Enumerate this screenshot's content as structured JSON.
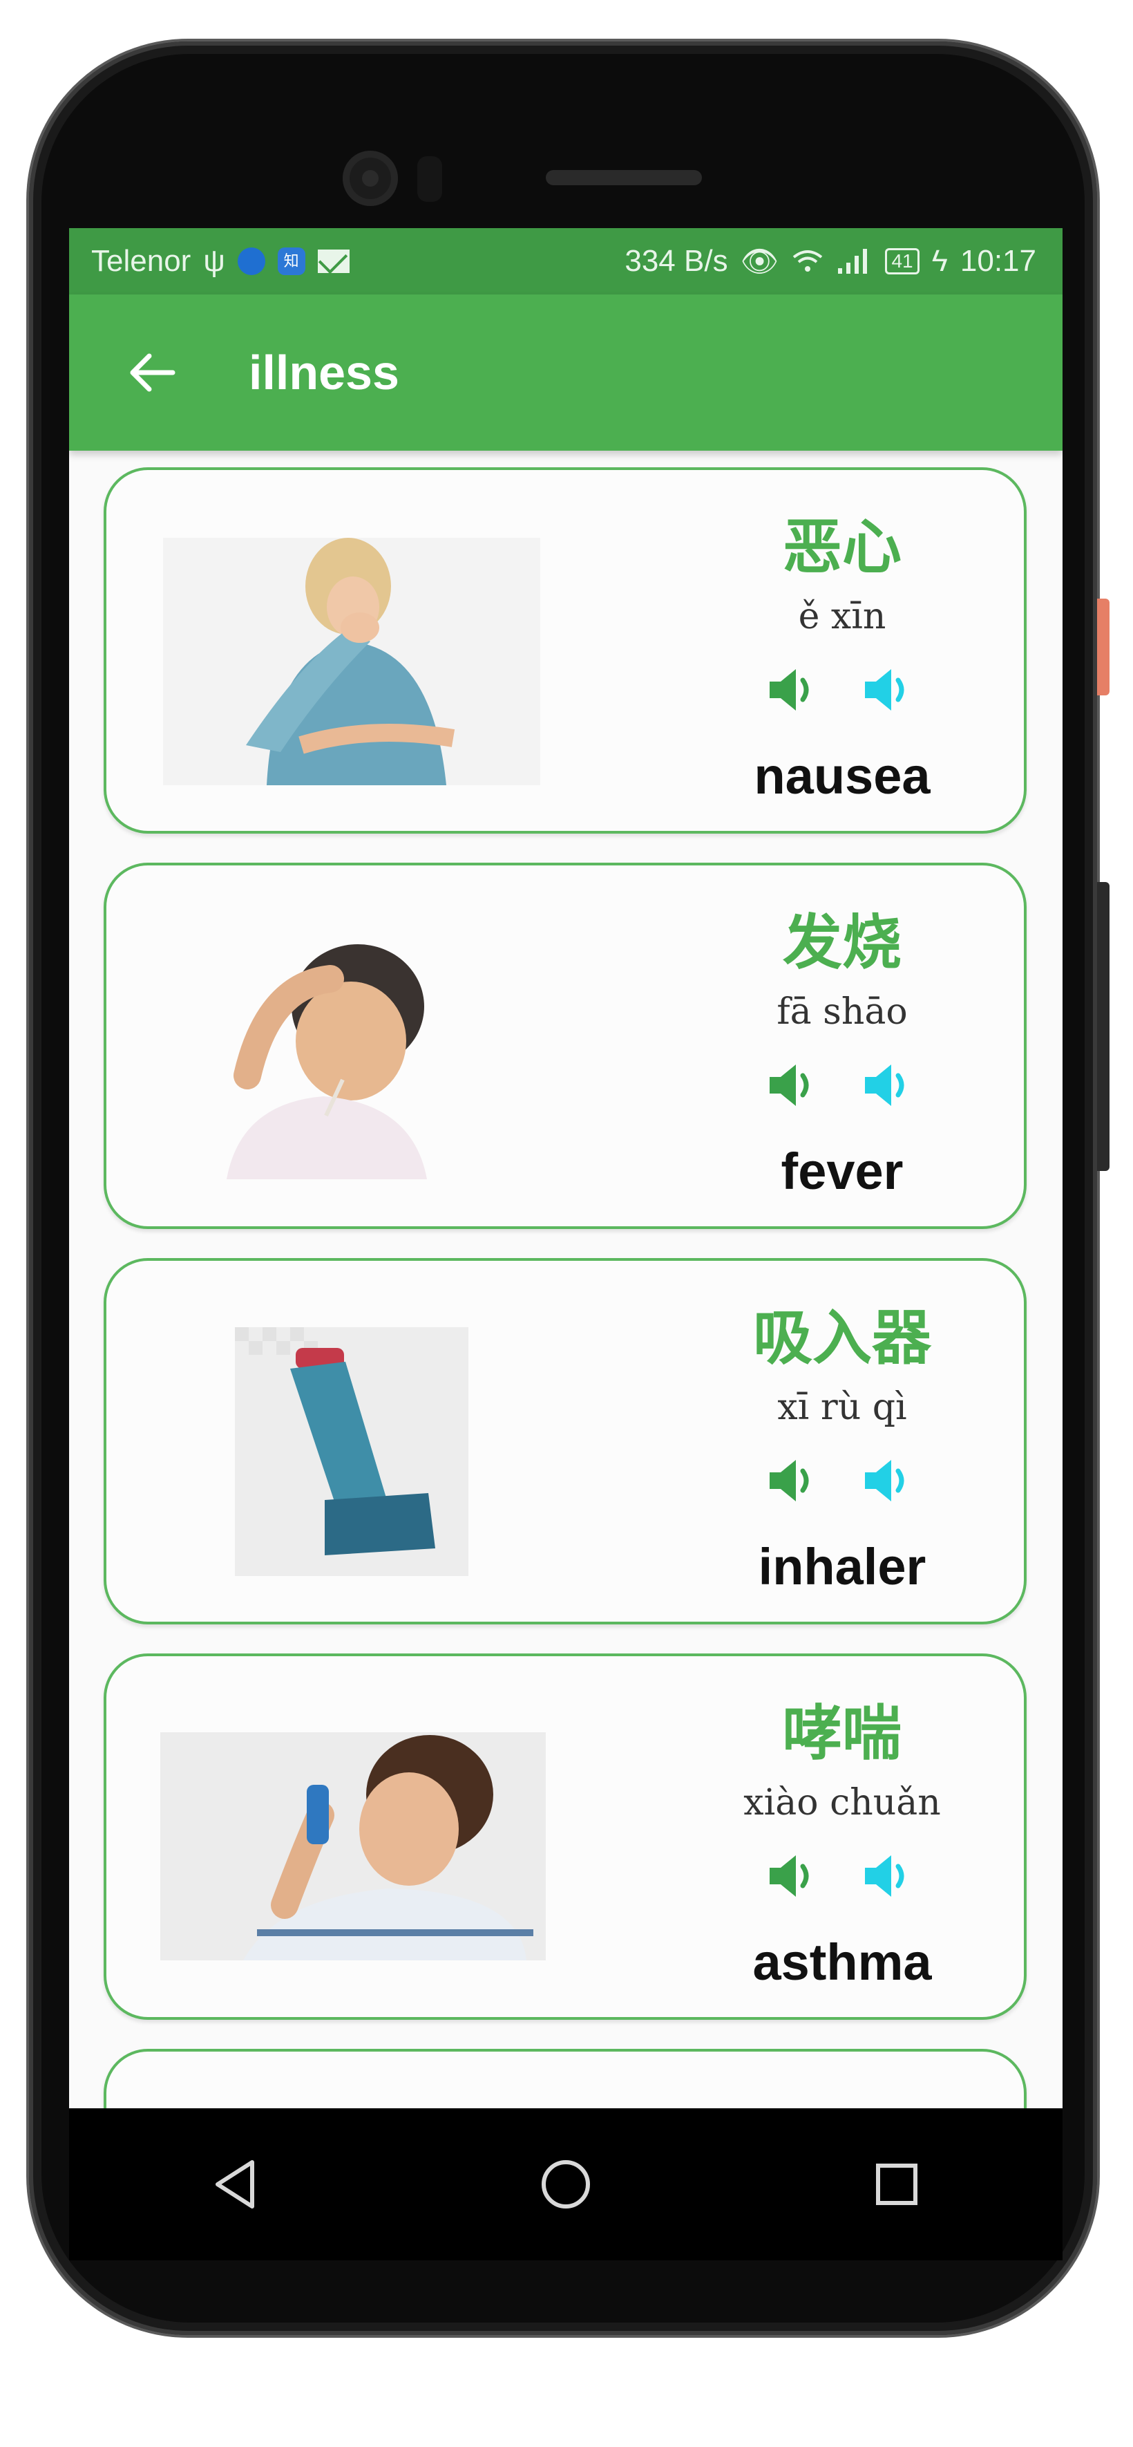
{
  "status_bar": {
    "carrier": "Telenor",
    "usb_icon": "usb-icon",
    "badge_text": "知",
    "speed": "334 B/s",
    "battery": "41",
    "time": "10:17"
  },
  "app_bar": {
    "title": "illness",
    "back_icon": "arrow-left-icon"
  },
  "colors": {
    "status_bar": "#3f9a45",
    "app_bar": "#4caf50",
    "accent_green": "#4caf50",
    "speaker_green": "#3aa14a",
    "speaker_cyan": "#22d0e6"
  },
  "cards": [
    {
      "hanzi": "恶心",
      "pinyin": "ě xīn",
      "english": "nausea",
      "image": "woman-nauseous-photo"
    },
    {
      "hanzi": "发烧",
      "pinyin": "fā shāo",
      "english": "fever",
      "image": "boy-with-thermometer-photo"
    },
    {
      "hanzi": "吸入器",
      "pinyin": "xī rù qì",
      "english": "inhaler",
      "image": "inhaler-photo"
    },
    {
      "hanzi": "哮喘",
      "pinyin": "xiào chuǎn",
      "english": "asthma",
      "image": "boy-using-inhaler-photo"
    }
  ],
  "nav_bar": {
    "back": "triangle-back-icon",
    "home": "circle-home-icon",
    "recents": "square-recents-icon"
  }
}
